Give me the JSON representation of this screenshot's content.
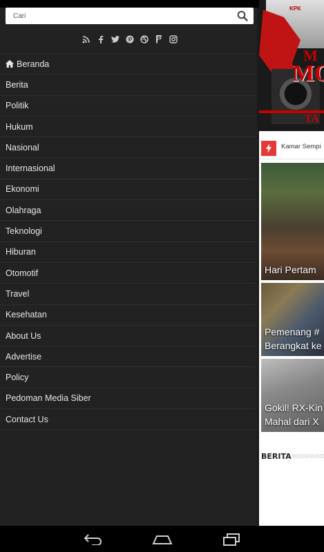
{
  "search": {
    "placeholder": "Cari"
  },
  "social_icons": [
    "rss-icon",
    "facebook-icon",
    "twitter-icon",
    "pinterest-icon",
    "dribbble-icon",
    "foursquare-icon",
    "instagram-icon"
  ],
  "menu": {
    "items": [
      {
        "label": "Beranda",
        "icon": "home-icon"
      },
      {
        "label": "Berita"
      },
      {
        "label": "Politik"
      },
      {
        "label": "Hukum"
      },
      {
        "label": "Nasional"
      },
      {
        "label": "Internasional"
      },
      {
        "label": "Ekonomi"
      },
      {
        "label": "Olahraga"
      },
      {
        "label": "Teknologi"
      },
      {
        "label": "Hiburan"
      },
      {
        "label": "Otomotif"
      },
      {
        "label": "Travel"
      },
      {
        "label": "Kesehatan"
      },
      {
        "label": "About Us"
      },
      {
        "label": "Advertise"
      },
      {
        "label": "Policy"
      },
      {
        "label": "Pedoman Media Siber"
      },
      {
        "label": "Contact Us"
      }
    ]
  },
  "banner": {
    "logo_text": "KPK",
    "text1": "M",
    "text2": "MO",
    "text3": "TA"
  },
  "ticker": {
    "text": "Kamar Sempi"
  },
  "articles": [
    {
      "title_line1": "Hari Pertam",
      "title_line2": ""
    },
    {
      "title_line1": "Pemenang #",
      "title_line2": "Berangkat ke"
    },
    {
      "title_line1": "Gokil! RX-Kin",
      "title_line2": "Mahal dari X"
    }
  ],
  "section": {
    "title": "BERITA"
  },
  "colors": {
    "drawer_bg": "#222222",
    "accent": "#e53935",
    "banner_red": "#c80000"
  },
  "navbar": [
    "back-icon",
    "home-icon",
    "recent-apps-icon"
  ]
}
